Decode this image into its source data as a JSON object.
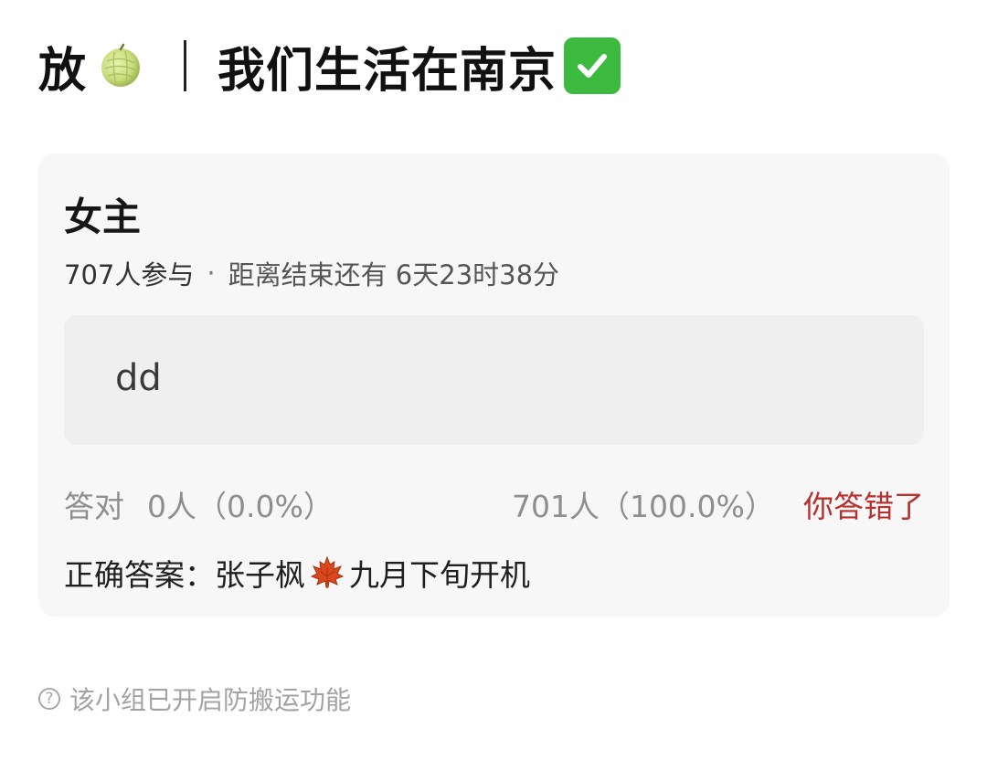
{
  "header": {
    "title_prefix": "放",
    "title_main": "我们生活在南京",
    "melon_icon": "melon-icon",
    "check_icon": "check-mark-button-icon",
    "check_color": "#3cb93f"
  },
  "poll": {
    "title": "女主",
    "participants": "707人参与",
    "separator": "·",
    "deadline": "距离结束还有 6天23时38分",
    "option": "dd",
    "correct_label": "答对",
    "correct_count": "0人（0.0%）",
    "wrong_count": "701人（100.0%）",
    "wrong_tag": "你答错了",
    "wrong_tag_color": "#b8302d",
    "answer_prefix": "正确答案：张子枫",
    "answer_suffix": "九月下旬开机",
    "leaf_icon": "maple-leaf-icon"
  },
  "footer": {
    "help_icon": "question-circle-icon",
    "help_glyph": "?",
    "note": "该小组已开启防搬运功能"
  }
}
